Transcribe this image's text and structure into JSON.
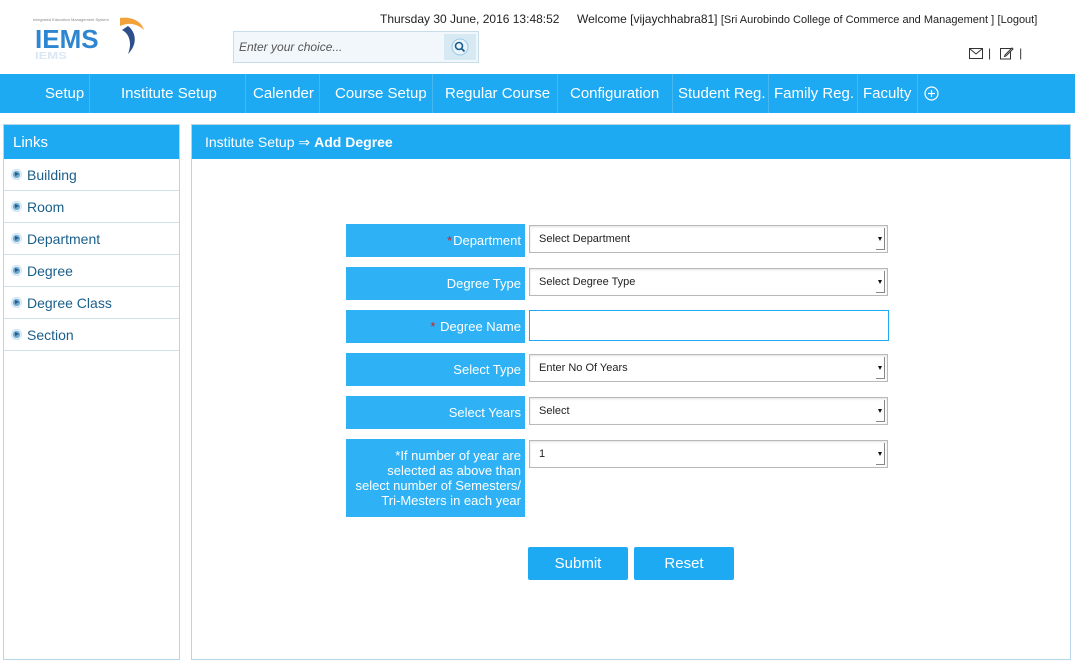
{
  "header": {
    "logo_text": "IEMS",
    "datetime": "Thursday 30 June, 2016 13:48:52",
    "welcome_prefix": "Welcome [vijaychhabra81]",
    "college": "[Sri Aurobindo College of Commerce and Management ]",
    "logout": "[Logout]",
    "search_placeholder": "Enter your choice...",
    "icons": [
      "mail-icon",
      "edit-icon"
    ]
  },
  "nav": {
    "items": [
      "Setup",
      "Institute Setup",
      "Calender",
      "Course Setup",
      "Regular Course",
      "Configuration",
      "Student Reg.",
      "Family Reg.",
      "Faculty"
    ]
  },
  "sidebar": {
    "title": "Links",
    "items": [
      "Building",
      "Room",
      "Department",
      "Degree",
      "Degree Class",
      "Section"
    ]
  },
  "breadcrumb": {
    "parent": "Institute Setup",
    "separator": "⇒",
    "current": "Add Degree"
  },
  "form": {
    "department_label": "Department",
    "department_value": "Select Department",
    "degree_type_label": "Degree Type",
    "degree_type_value": "Select Degree Type",
    "degree_name_label": "Degree Name",
    "degree_name_value": "",
    "select_type_label": "Select Type",
    "select_type_value": "Enter No Of Years",
    "select_years_label": "Select Years",
    "select_years_value": "Select",
    "semesters_label_lines": [
      "*If number of year are",
      "selected as above than",
      "select number of Semesters/",
      "Tri-Mesters in each year"
    ],
    "semesters_value": "1",
    "required_mark": "*",
    "submit": "Submit",
    "reset": "Reset"
  },
  "colors": {
    "primary": "#1daaf3",
    "label_bg": "#2eb2f5",
    "required": "#d21f1f"
  }
}
